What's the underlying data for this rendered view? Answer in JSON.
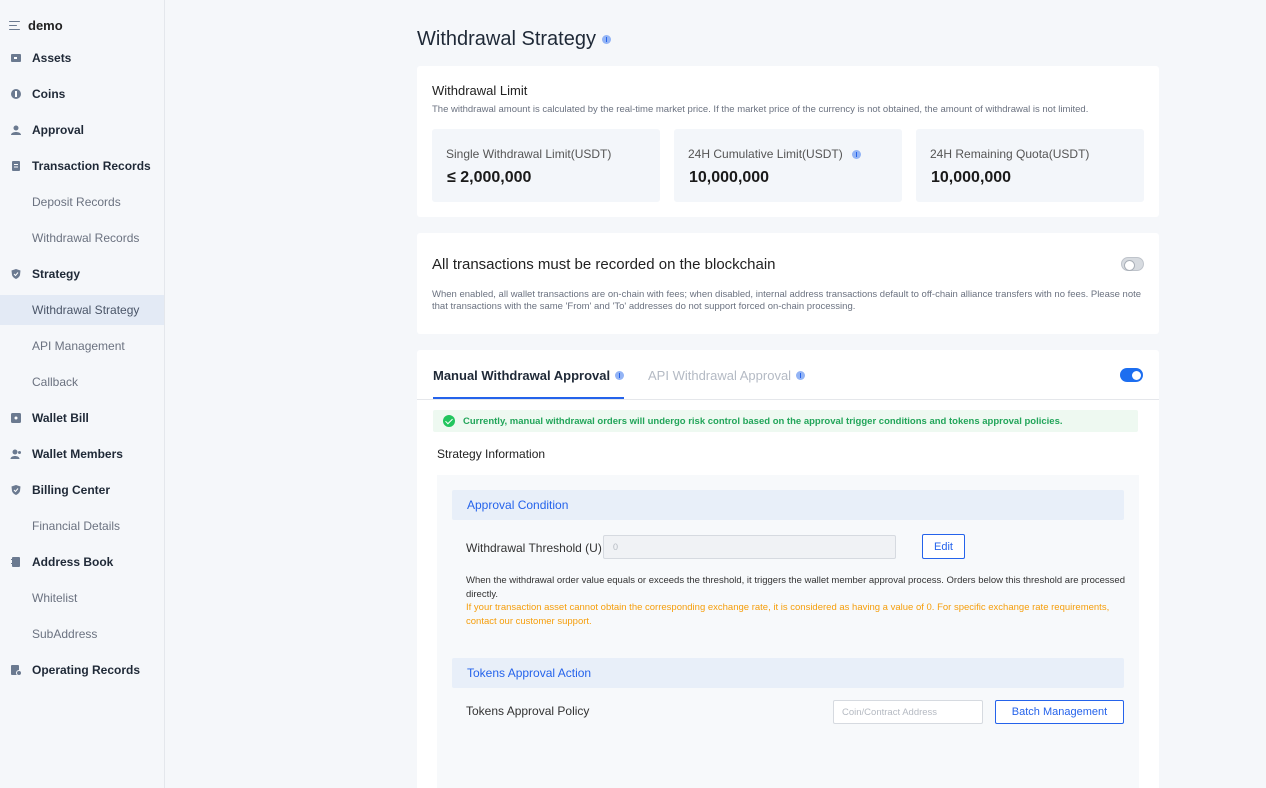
{
  "sidebar": {
    "title": "demo",
    "items": [
      {
        "label": "Assets",
        "icon": "wallet-icon"
      },
      {
        "label": "Coins",
        "icon": "coin-icon"
      },
      {
        "label": "Approval",
        "icon": "user-icon"
      },
      {
        "label": "Transaction Records",
        "icon": "document-icon"
      },
      {
        "label": "Deposit Records"
      },
      {
        "label": "Withdrawal Records"
      },
      {
        "label": "Strategy",
        "icon": "shield-icon"
      },
      {
        "label": "Withdrawal Strategy"
      },
      {
        "label": "API Management"
      },
      {
        "label": "Callback"
      },
      {
        "label": "Wallet Bill",
        "icon": "bill-icon"
      },
      {
        "label": "Wallet Members",
        "icon": "members-icon"
      },
      {
        "label": "Billing Center",
        "icon": "shield-icon"
      },
      {
        "label": "Financial Details"
      },
      {
        "label": "Address Book",
        "icon": "book-icon"
      },
      {
        "label": "Whitelist"
      },
      {
        "label": "SubAddress"
      },
      {
        "label": "Operating Records",
        "icon": "records-icon"
      }
    ]
  },
  "page": {
    "title": "Withdrawal Strategy"
  },
  "withdrawal_limit": {
    "heading": "Withdrawal Limit",
    "description": "The withdrawal amount is calculated by the real-time market price. If the market price of the currency is not obtained, the amount of withdrawal is not limited.",
    "boxes": [
      {
        "label": "Single Withdrawal Limit(USDT)",
        "value": "≤ 2,000,000"
      },
      {
        "label": "24H Cumulative Limit(USDT)",
        "value": "10,000,000"
      },
      {
        "label": "24H Remaining Quota(USDT)",
        "value": "10,000,000"
      }
    ]
  },
  "blockchain": {
    "heading": "All transactions must be recorded on the blockchain",
    "description": "When enabled, all wallet transactions are on-chain with fees; when disabled, internal address transactions default to off-chain alliance transfers with no fees. Please note that transactions with the same 'From' and 'To' addresses do not support forced on-chain processing.",
    "enabled": false
  },
  "approval": {
    "tabs": [
      "Manual Withdrawal Approval",
      "API Withdrawal Approval"
    ],
    "enabled": true,
    "alert": "Currently, manual withdrawal orders will undergo risk control based on the approval trigger conditions and tokens approval policies.",
    "strategy_info": "Strategy Information",
    "condition": {
      "heading": "Approval Condition",
      "threshold_label": "Withdrawal Threshold (U)",
      "threshold_value": "0",
      "edit_label": "Edit",
      "description": "When the withdrawal order value equals or exceeds the threshold, it triggers the wallet member approval process. Orders below this threshold are processed directly.",
      "warning": "If your transaction asset cannot obtain the corresponding exchange rate, it is considered as having a value of 0. For specific exchange rate requirements, contact our customer support."
    },
    "tokens": {
      "heading": "Tokens Approval Action",
      "policy_label": "Tokens Approval Policy",
      "search_placeholder": "Coin/Contract Address",
      "batch_label": "Batch Management"
    }
  },
  "colors": {
    "accent": "#2563eb",
    "success": "#22c55e",
    "warning": "#f59e0b",
    "active_bg": "#e3eaf5"
  }
}
